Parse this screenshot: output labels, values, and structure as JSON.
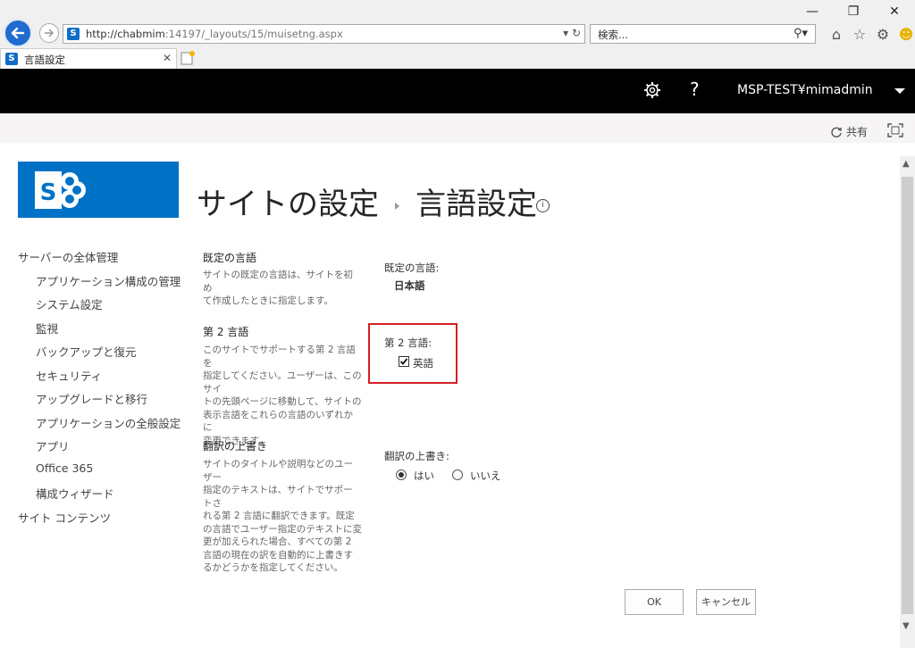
{
  "browser": {
    "url_host": "http://chabmim",
    "url_rest": ":14197/_layouts/15/muisetng.aspx",
    "search_placeholder": "検索...",
    "tab_title": "言語設定"
  },
  "suite_bar": {
    "user": "MSP-TEST¥mimadmin",
    "help": "?"
  },
  "ribbon": {
    "share_label": "共有"
  },
  "header": {
    "breadcrumb_parent": "サイトの設定",
    "page_title": "言語設定",
    "info_glyph": "i"
  },
  "left_nav": {
    "items": [
      {
        "label": "サーバーの全体管理",
        "level": 0
      },
      {
        "label": "アプリケーション構成の管理",
        "level": 1
      },
      {
        "label": "システム設定",
        "level": 1
      },
      {
        "label": "監視",
        "level": 1
      },
      {
        "label": "バックアップと復元",
        "level": 1
      },
      {
        "label": "セキュリティ",
        "level": 1
      },
      {
        "label": "アップグレードと移行",
        "level": 1
      },
      {
        "label": "アプリケーションの全般設定",
        "level": 1
      },
      {
        "label": "アプリ",
        "level": 1
      },
      {
        "label": "Office 365",
        "level": 1
      },
      {
        "label": "構成ウィザード",
        "level": 1
      },
      {
        "label": "サイト コンテンツ",
        "level": 0
      }
    ]
  },
  "sections": {
    "default_language": {
      "title": "既定の言語",
      "desc_lines": [
        "サイトの既定の言語は、サイトを初め",
        "て作成したときに指定します。"
      ],
      "field_label": "既定の言語:",
      "field_value": "日本語"
    },
    "secondary_language": {
      "title": "第 2 言語",
      "desc_lines": [
        "このサイトでサポートする第 2 言語を",
        "指定してください。ユーザーは、このサイ",
        "トの先頭ページに移動して、サイトの",
        "表示言語をこれらの言語のいずれかに",
        "変更できます。"
      ],
      "field_label": "第 2 言語:",
      "checkbox_label": "英語",
      "checkbox_checked": true
    },
    "overwrite_translations": {
      "title": "翻訳の上書き",
      "desc_lines": [
        "サイトのタイトルや説明などのユーザー",
        "指定のテキストは、サイトでサポートさ",
        "れる第 2 言語に翻訳できます。既定",
        "の言語でユーザー指定のテキストに変",
        "更が加えられた場合、すべての第 2",
        "言語の現在の訳を自動的に上書きす",
        "るかどうかを指定してください。"
      ],
      "field_label": "翻訳の上書き:",
      "option_yes": "はい",
      "option_no": "いいえ",
      "selected": "はい"
    }
  },
  "buttons": {
    "ok": "OK",
    "cancel": "キャンセル"
  }
}
